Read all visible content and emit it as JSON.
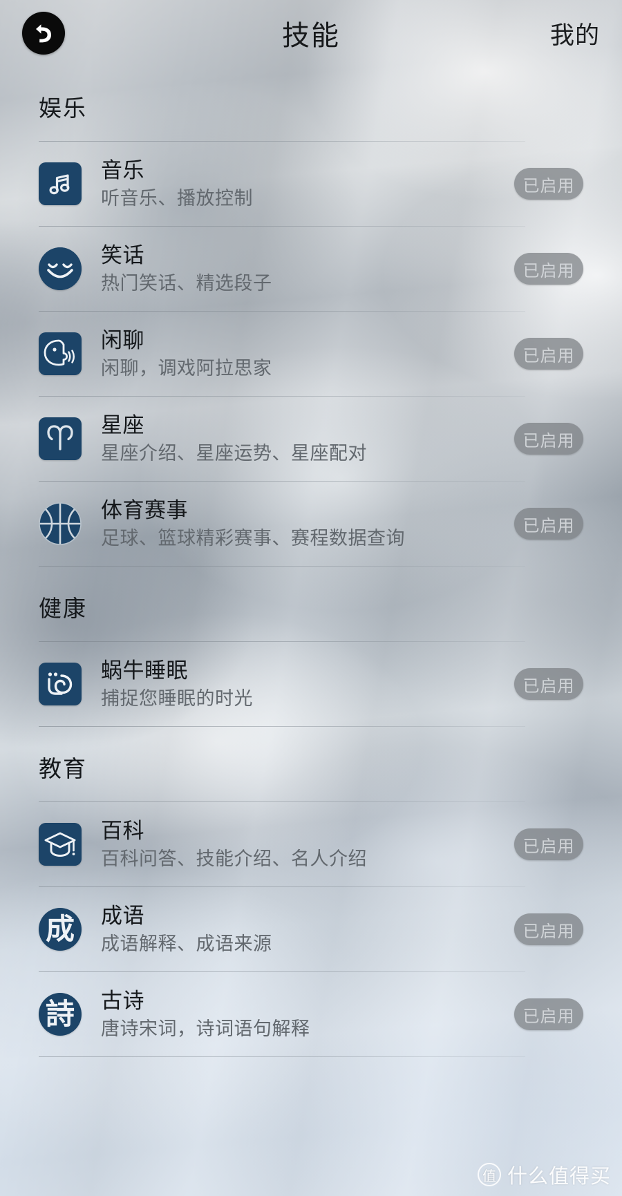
{
  "header": {
    "back_icon": "back-arrow-icon",
    "title": "技能",
    "right_link": "我的"
  },
  "action_label": "已启用",
  "sections": [
    {
      "title": "娱乐",
      "items": [
        {
          "icon": "music-note-icon",
          "icon_shape": "rounded",
          "title": "音乐",
          "desc": "听音乐、播放控制",
          "action": "已启用"
        },
        {
          "icon": "smiley-face-icon",
          "icon_shape": "circle",
          "title": "笑话",
          "desc": "热门笑话、精选段子",
          "action": "已启用"
        },
        {
          "icon": "talking-face-icon",
          "icon_shape": "rounded",
          "title": "闲聊",
          "desc": "闲聊，调戏阿拉思家",
          "action": "已启用"
        },
        {
          "icon": "aries-zodiac-icon",
          "icon_shape": "rounded",
          "title": "星座",
          "desc": "星座介绍、星座运势、星座配对",
          "action": "已启用"
        },
        {
          "icon": "basketball-icon",
          "icon_shape": "plain",
          "title": "体育赛事",
          "desc": "足球、篮球精彩赛事、赛程数据查询",
          "action": "已启用"
        }
      ]
    },
    {
      "title": "健康",
      "items": [
        {
          "icon": "snail-sleep-icon",
          "icon_shape": "rounded",
          "title": "蜗牛睡眠",
          "desc": "捕捉您睡眠的时光",
          "action": "已启用"
        }
      ]
    },
    {
      "title": "教育",
      "items": [
        {
          "icon": "graduation-cap-icon",
          "icon_shape": "rounded",
          "title": "百科",
          "desc": "百科问答、技能介绍、名人介绍",
          "action": "已启用"
        },
        {
          "icon": "cheng-character-icon",
          "icon_shape": "circle",
          "icon_glyph": "成",
          "title": "成语",
          "desc": "成语解释、成语来源",
          "action": "已启用"
        },
        {
          "icon": "shi-character-icon",
          "icon_shape": "circle",
          "icon_glyph": "詩",
          "title": "古诗",
          "desc": "唐诗宋词，诗词语句解释",
          "action": "已启用"
        }
      ]
    }
  ],
  "watermark": {
    "badge": "值",
    "text": "什么值得买"
  },
  "colors": {
    "icon_blue": "#1c4468",
    "action_gray": "#7a7e82",
    "title_text": "#15181b",
    "desc_text": "#62686e"
  }
}
